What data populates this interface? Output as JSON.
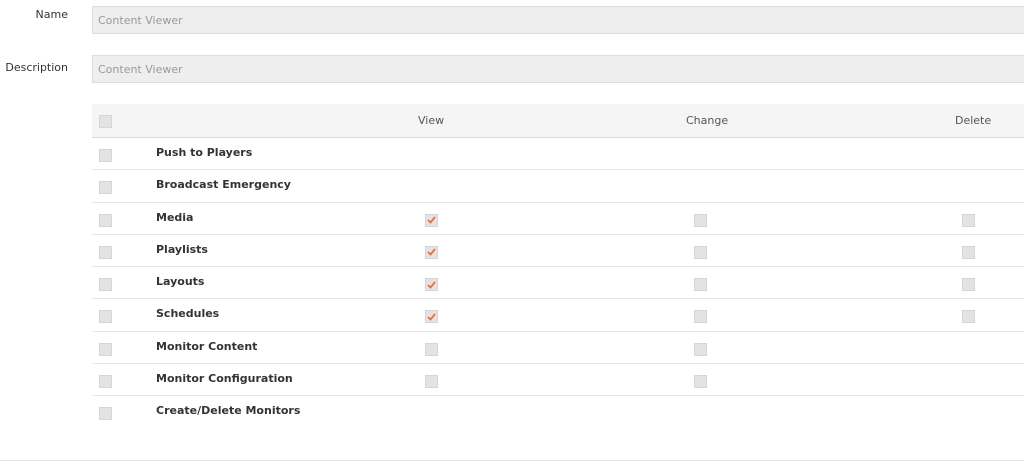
{
  "form": {
    "name_label": "Name",
    "name_value": "Content Viewer",
    "description_label": "Description",
    "description_value": "Content Viewer"
  },
  "table": {
    "headers": {
      "view": "View",
      "change": "Change",
      "delete": "Delete"
    },
    "rows": [
      {
        "label": "Push to Players",
        "view": null,
        "change": null,
        "delete": null
      },
      {
        "label": "Broadcast Emergency",
        "view": null,
        "change": null,
        "delete": null
      },
      {
        "label": "Media",
        "view": true,
        "change": false,
        "delete": false
      },
      {
        "label": "Playlists",
        "view": true,
        "change": false,
        "delete": false
      },
      {
        "label": "Layouts",
        "view": true,
        "change": false,
        "delete": false
      },
      {
        "label": "Schedules",
        "view": true,
        "change": false,
        "delete": false
      },
      {
        "label": "Monitor Content",
        "view": false,
        "change": false,
        "delete": null
      },
      {
        "label": "Monitor Configuration",
        "view": false,
        "change": false,
        "delete": null
      },
      {
        "label": "Create/Delete Monitors",
        "view": null,
        "change": null,
        "delete": null
      }
    ]
  },
  "colors": {
    "check_accent": "#e8733a"
  }
}
